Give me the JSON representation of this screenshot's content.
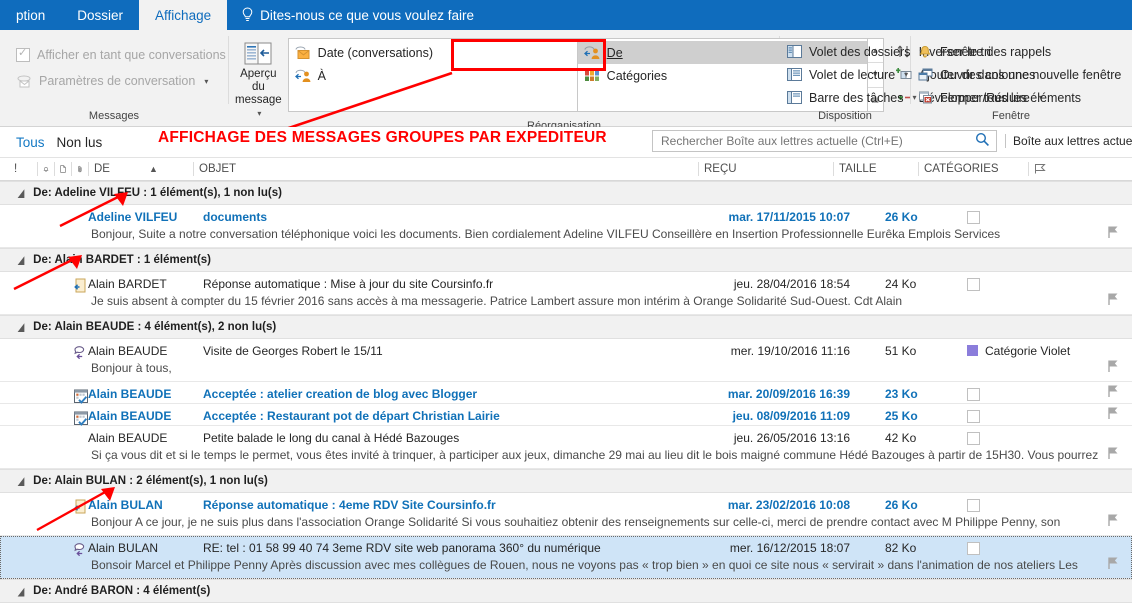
{
  "ribbon": {
    "tabs": [
      {
        "label": "ption",
        "active": false
      },
      {
        "label": "Dossier",
        "active": false
      },
      {
        "label": "Affichage",
        "active": true
      }
    ],
    "tell_me": "Dites-nous ce que vous voulez faire",
    "groups": {
      "messages": {
        "label": "Messages",
        "check_conversations": "Afficher en tant que conversations",
        "conversation_settings": "Paramètres de conversation"
      },
      "arrangement": {
        "label": "Réorganisation",
        "preview_button": "Aperçu du message",
        "sort_items": [
          {
            "label": "Date (conversations)",
            "icon": "mail-date-icon",
            "selected": false
          },
          {
            "label": "À",
            "icon": "to-person-icon",
            "selected": false
          },
          {
            "label": "De",
            "icon": "from-person-icon",
            "selected": true
          },
          {
            "label": "Catégories",
            "icon": "categories-icon",
            "selected": false
          }
        ],
        "commands": [
          {
            "label": "Inverser le tri",
            "icon": "reverse-sort-icon"
          },
          {
            "label": "Ajouter des colonnes",
            "icon": "add-columns-icon"
          },
          {
            "label": "Développer/Réduire",
            "icon": "expand-collapse-icon",
            "caret": true
          }
        ]
      },
      "layout": {
        "label": "Disposition",
        "commands": [
          {
            "label": "Volet des dossiers",
            "icon": "folder-pane-icon",
            "caret": true
          },
          {
            "label": "Volet de lecture",
            "icon": "reading-pane-icon",
            "caret": true
          },
          {
            "label": "Barre des tâches",
            "icon": "todo-bar-icon",
            "caret": true
          }
        ]
      },
      "window": {
        "label": "Fenêtre",
        "commands": [
          {
            "label": "Fenêtre des rappels",
            "icon": "bell-icon",
            "caret": false
          },
          {
            "label": "Ouvrir dans une nouvelle fenêtre",
            "icon": "new-window-icon",
            "caret": false
          },
          {
            "label": "Fermer tous les éléments",
            "icon": "close-all-icon",
            "caret": false
          }
        ]
      }
    }
  },
  "annotation": {
    "banner": "AFFICHAGE DES MESSAGES GROUPES PAR EXPEDITEUR",
    "color": "#ff0000"
  },
  "filter_bar": {
    "all": "Tous",
    "unread": "Non lus",
    "selected": "Tous"
  },
  "search": {
    "placeholder": "Rechercher Boîte aux lettres actuelle (Ctrl+E)",
    "value": "",
    "icon": "search-icon",
    "scope": "Boîte aux lettres actuel"
  },
  "columns": [
    {
      "label": "!",
      "name": "importance"
    },
    {
      "label": "⌂",
      "name": "reminder"
    },
    {
      "label": "🗋",
      "name": "item-type"
    },
    {
      "label": "◍",
      "name": "attachment"
    },
    {
      "label": "DE",
      "name": "from",
      "sorted": true,
      "sort_dir": "asc"
    },
    {
      "label": "OBJET",
      "name": "subject"
    },
    {
      "label": "REÇU",
      "name": "received"
    },
    {
      "label": "TAILLE",
      "name": "size"
    },
    {
      "label": "CATÉGORIES",
      "name": "categories"
    },
    {
      "label": "",
      "name": "flag"
    }
  ],
  "groups": [
    {
      "header": "De: Adeline VILFEU : 1 élément(s), 1 non lu(s)",
      "messages": [
        {
          "from": "Adeline VILFEU",
          "subject": "documents",
          "received": "mar. 17/11/2015 10:07",
          "size": "26 Ko",
          "category": "",
          "category_color": "",
          "preview": "Bonjour,   Suite a notre conversation téléphonique voici les documents.   Bien cordialement   Adeline VILFEU  Conseillère en Insertion Professionnelle   Eurêka Emplois Services",
          "unread": true,
          "icon": "none",
          "selected": false
        }
      ]
    },
    {
      "header": "De: Alain BARDET : 1 élément(s)",
      "messages": [
        {
          "from": "Alain BARDET",
          "subject": "Réponse automatique : Mise à jour du site Coursinfo.fr",
          "received": "jeu. 28/04/2016 18:54",
          "size": "24 Ko",
          "category": "",
          "category_color": "",
          "preview": "Je suis absent à compter du 15 février 2016 sans accès à ma messagerie.  Patrice Lambert assure mon intérim à Orange Solidarité Sud-Ouest.  Cdt  Alain <fin>",
          "unread": false,
          "icon": "replied-note-icon",
          "selected": false
        }
      ]
    },
    {
      "header": "De: Alain BEAUDE : 4 élément(s), 2 non lu(s)",
      "messages": [
        {
          "from": "Alain BEAUDE",
          "subject": "Visite de Georges Robert le 15/11",
          "received": "mer. 19/10/2016 11:16",
          "size": "51 Ko",
          "category": "Catégorie Violet",
          "category_color": "#8b7ddb",
          "preview": "Bonjour à tous,",
          "unread": false,
          "icon": "replied-mail-icon",
          "selected": false
        },
        {
          "from": "Alain BEAUDE",
          "subject": "Acceptée : atelier creation de blog avec Blogger",
          "received": "mar. 20/09/2016 16:39",
          "size": "23 Ko",
          "category": "",
          "category_color": "",
          "preview": "",
          "unread": true,
          "icon": "meeting-accept-icon",
          "selected": false,
          "short": true
        },
        {
          "from": "Alain BEAUDE",
          "subject": "Acceptée : Restaurant pot de départ Christian Lairie",
          "received": "jeu. 08/09/2016 11:09",
          "size": "25 Ko",
          "category": "",
          "category_color": "",
          "preview": "",
          "unread": true,
          "icon": "meeting-accept-icon",
          "selected": false,
          "short": true
        },
        {
          "from": "Alain BEAUDE",
          "subject": "Petite balade le long du canal à Hédé Bazouges",
          "received": "jeu. 26/05/2016 13:16",
          "size": "42 Ko",
          "category": "",
          "category_color": "",
          "preview": "Si ça vous dit et si le temps le permet, vous êtes invité à trinquer, à participer aux jeux, dimanche 29 mai au lieu dit le bois maigné  commune Hédé Bazouges à partir de 15H30. Vous pourrez",
          "unread": false,
          "icon": "none",
          "selected": false
        }
      ]
    },
    {
      "header": "De: Alain BULAN : 2 élément(s), 1 non lu(s)",
      "messages": [
        {
          "from": "Alain BULAN",
          "subject": "Réponse automatique : 4eme RDV Site Coursinfo.fr",
          "received": "mar. 23/02/2016 10:08",
          "size": "26 Ko",
          "category": "",
          "category_color": "",
          "preview": "Bonjour  A ce jour, je ne suis plus dans l'association Orange Solidarité  Si vous souhaitiez obtenir des renseignements sur celle-ci, merci de prendre contact avec M Philippe Penny, son",
          "unread": true,
          "icon": "replied-note-icon",
          "selected": false
        },
        {
          "from": "Alain BULAN",
          "subject": "RE: tel : 01 58 99 40 74     3eme RDV site web panorama 360° du numérique",
          "received": "mer. 16/12/2015 18:07",
          "size": "82 Ko",
          "category": "",
          "category_color": "",
          "preview": "Bonsoir Marcel et Philippe Penny  Après discussion avec mes collègues de Rouen, nous ne voyons pas « trop bien » en quoi ce site nous « servirait » dans l'animation de nos ateliers  Les",
          "unread": false,
          "icon": "replied-mail-icon",
          "selected": true
        }
      ]
    },
    {
      "header": "De: André BARON : 4 élément(s)",
      "messages": []
    }
  ]
}
